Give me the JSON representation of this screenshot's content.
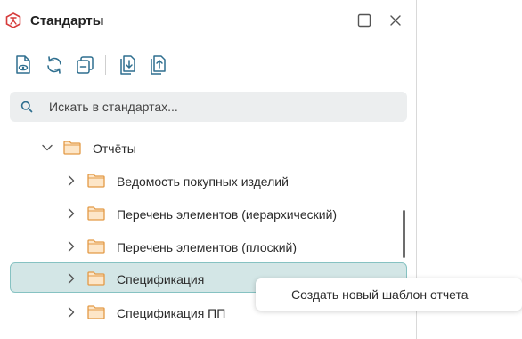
{
  "panel": {
    "title": "Стандарты",
    "app_icon": "kompas-standards-icon",
    "window_buttons": [
      "maximize-icon",
      "close-icon"
    ]
  },
  "toolbar": {
    "buttons": [
      "document-view-icon",
      "refresh-icon",
      "collapse-icon",
      "import-icon",
      "export-icon"
    ]
  },
  "search": {
    "placeholder": "Искать в стандартах...",
    "value": ""
  },
  "tree": {
    "parent": {
      "label": "Отчёты",
      "expanded": true
    },
    "items": [
      {
        "label": "Ведомость покупных изделий",
        "selected": false
      },
      {
        "label": "Перечень элементов (иерархический)",
        "selected": false
      },
      {
        "label": "Перечень элементов (плоский)",
        "selected": false
      },
      {
        "label": "Спецификация",
        "selected": true
      },
      {
        "label": "Спецификация ПП",
        "selected": false
      }
    ]
  },
  "context_menu": {
    "items": [
      {
        "label": "Создать новый шаблон отчета"
      }
    ]
  },
  "colors": {
    "accent": "#d63b3b",
    "folder_fill": "#fde6c8",
    "folder_stroke": "#e39a46",
    "toolbar_icon": "#2f6f8f",
    "selection_bg": "#d3e6e6",
    "selection_border": "#86c2c2"
  }
}
